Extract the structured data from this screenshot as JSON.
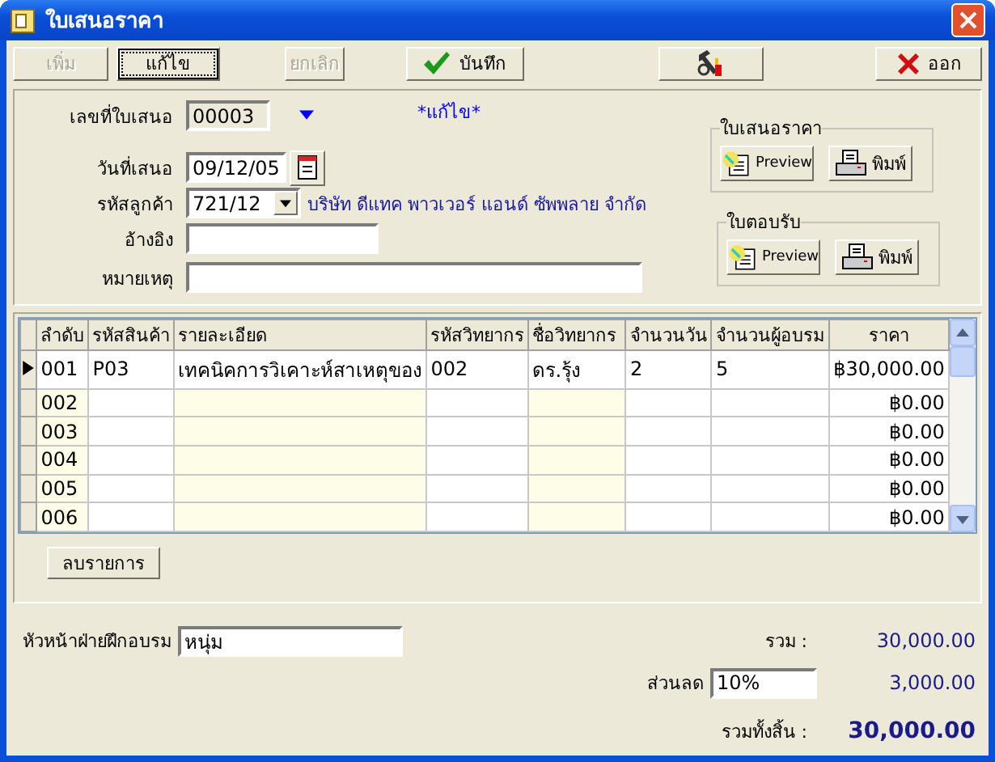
{
  "window": {
    "title": "ใบเสนอราคา"
  },
  "toolbar": [
    {
      "kind": "text",
      "label": "เพิ่ม",
      "disabled": true,
      "focused": false
    },
    {
      "kind": "text",
      "label": "แก้ไข",
      "disabled": false,
      "focused": true
    },
    {
      "kind": "text",
      "label": "ยกเลิก",
      "disabled": true,
      "focused": false
    },
    {
      "kind": "save",
      "label": "บันทึก",
      "disabled": false,
      "focused": false
    },
    {
      "kind": "tools",
      "disabled": false,
      "focused": false
    },
    {
      "kind": "exit",
      "label": "ออก",
      "disabled": false,
      "focused": false
    }
  ],
  "form": {
    "quote_no": {
      "label": "เลขที่ใบเสนอ",
      "value": "00003"
    },
    "mode": "*แก้ไข*",
    "date": {
      "label": "วันที่เสนอ",
      "value": "09/12/05"
    },
    "customer": {
      "label": "รหัสลูกค้า",
      "value": "721/12",
      "name": "บริษัท ดีแทค พาวเวอร์ แอนด์ ซัพพลาย จำกัด"
    },
    "reference": {
      "label": "อ้างอิง"
    },
    "note": {
      "label": "หมายเหตุ"
    }
  },
  "print_groups": [
    {
      "title": "ใบเสนอราคา",
      "buttons": [
        {
          "kind": "preview",
          "label": "Preview"
        },
        {
          "kind": "print",
          "label": "พิมพ์"
        }
      ]
    },
    {
      "title": "ใบตอบรับ",
      "buttons": [
        {
          "kind": "preview",
          "label": "Preview"
        },
        {
          "kind": "print",
          "label": "พิมพ์"
        }
      ]
    }
  ],
  "table": {
    "columns": [
      {
        "label": "ลำดับ",
        "shaded": true
      },
      {
        "label": "รหัสสินค้า",
        "shaded": false
      },
      {
        "label": "รายละเอียด",
        "shaded": true
      },
      {
        "label": "รหัสวิทยากร",
        "shaded": false
      },
      {
        "label": "ชื่อวิทยากร",
        "shaded": true
      },
      {
        "label": "จำนวนวัน",
        "shaded": false
      },
      {
        "label": "จำนวนผู้อบรม",
        "shaded": false
      },
      {
        "label": "ราคา",
        "shaded": false
      }
    ],
    "rows": [
      {
        "selected": true,
        "no": "001",
        "product_code": "P03",
        "detail": "เทคนิคการวิเคาะห์สาเหตุของ",
        "trainer_code": "002",
        "trainer_name": "ดร.รุ้ง",
        "days": "2",
        "trainees": "5",
        "price": "฿30,000.00"
      },
      {
        "selected": false,
        "no": "002",
        "price": "฿0.00"
      },
      {
        "selected": false,
        "no": "003",
        "price": "฿0.00"
      },
      {
        "selected": false,
        "no": "004",
        "price": "฿0.00"
      },
      {
        "selected": false,
        "no": "005",
        "price": "฿0.00"
      },
      {
        "selected": false,
        "no": "006",
        "price": "฿0.00"
      }
    ]
  },
  "delete_button": "ลบรายการ",
  "footer": {
    "supervisor": {
      "label": "หัวหน้าฝ่ายฝึกอบรม",
      "value": "หนุ่ม"
    },
    "total": {
      "label": "รวม :",
      "value": "30,000.00"
    },
    "discount": {
      "label": "ส่วนลด",
      "value": "10%",
      "amount": "3,000.00"
    },
    "grand_total": {
      "label": "รวมทั้งสิ้น :",
      "value": "30,000.00"
    }
  }
}
